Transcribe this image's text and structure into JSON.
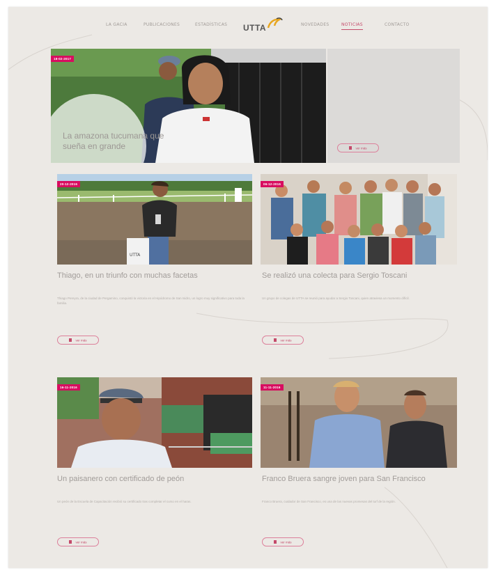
{
  "nav": {
    "left": [
      "La Gacia",
      "Publicaciones",
      "Estadísticas"
    ],
    "right": [
      "Novedades",
      "Noticias",
      "Contacto"
    ],
    "active": "Noticias",
    "logo_text": "UTTA"
  },
  "featured": {
    "date": "18-02-2017",
    "title": "La amazona tucumana que sueña en grande",
    "more_label": "ver más"
  },
  "cards": [
    {
      "date": "20-12-2016",
      "title": "Thiago, en un triunfo con muchas facetas",
      "excerpt": "Thiago Pereyra, de la ciudad de Pergamino, conquistó la victoria en el Hipódromo de San Isidro, un logro muy significativo para toda la familia.",
      "more_label": "ver más"
    },
    {
      "date": "06-12-2016",
      "title": "Se realizó una colecta para Sergio Toscani",
      "excerpt": "Un grupo de colegas de UTTA se reunió para ayudar a Sergio Toscani, quien atraviesa un momento difícil.",
      "more_label": "ver más"
    },
    {
      "date": "16-11-2016",
      "title": "Un paisanero con certificado de peón",
      "excerpt": "Un peón de la Escuela de Capacitación recibió su certificado tras completar el curso en el haras.",
      "more_label": "ver más"
    },
    {
      "date": "11-11-2016",
      "title": "Franco Bruera sangre joven para San Francisco",
      "excerpt": "Franco Bruera, cuidador de San Francisco, es una de las nuevas promesas del turf de la región.",
      "more_label": "ver más"
    }
  ],
  "colors": {
    "accent": "#d80d60",
    "background": "#ece9e5",
    "title_text": "#a19c99"
  }
}
